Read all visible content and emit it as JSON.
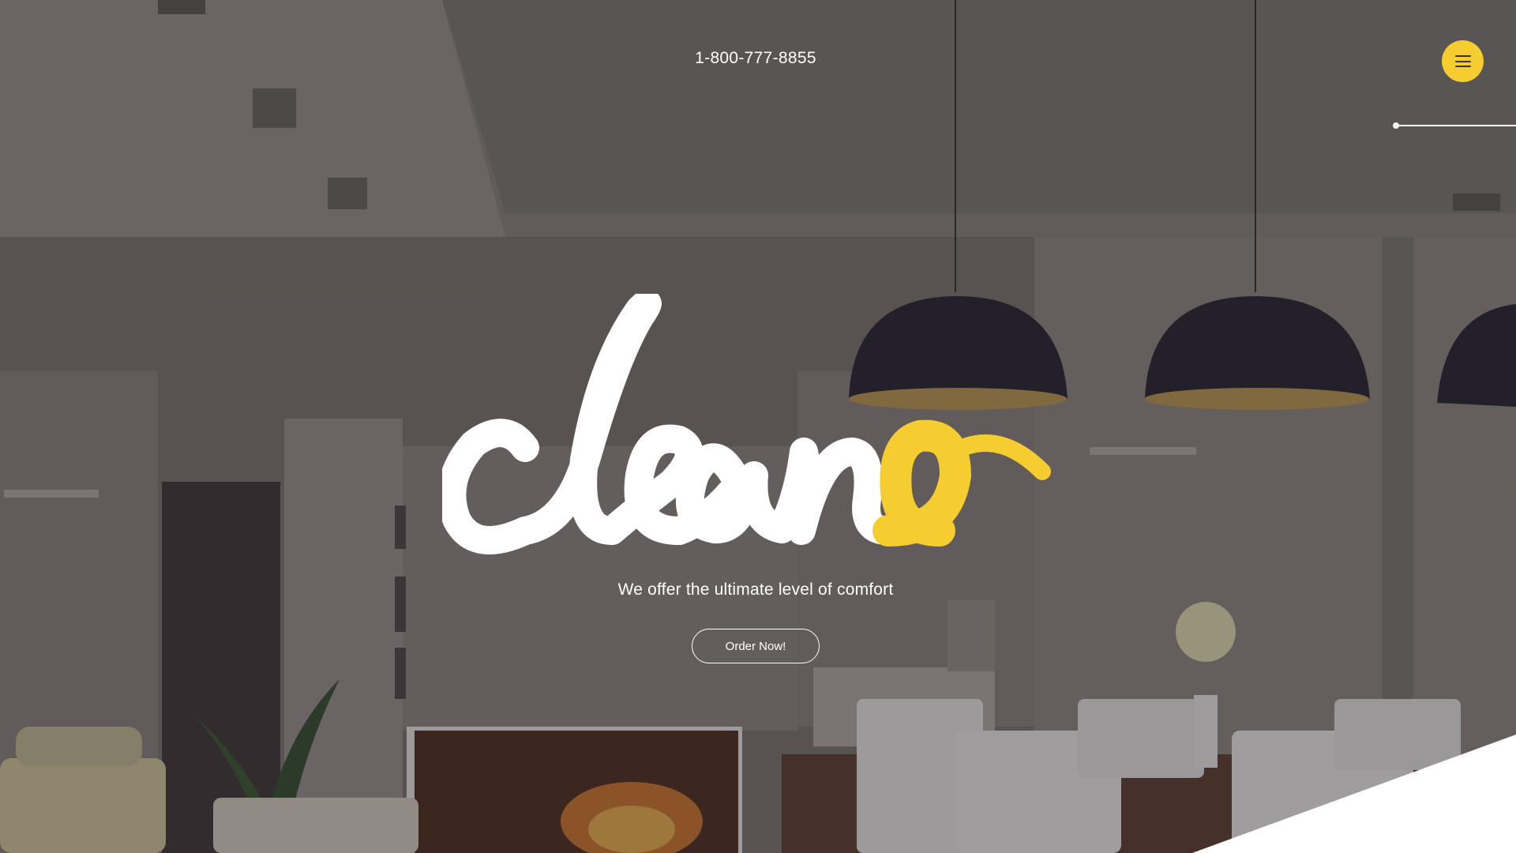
{
  "header": {
    "phone": "1-800-777-8855",
    "menu_icon": "hamburger-menu-icon"
  },
  "hero": {
    "logo_icon": "cleano-script-logo",
    "tagline": "We offer the ultimate level of comfort",
    "cta_label": "Order Now!"
  },
  "colors": {
    "accent": "#f5cd2e",
    "text": "#ffffff",
    "overlay": "#4a4446"
  }
}
